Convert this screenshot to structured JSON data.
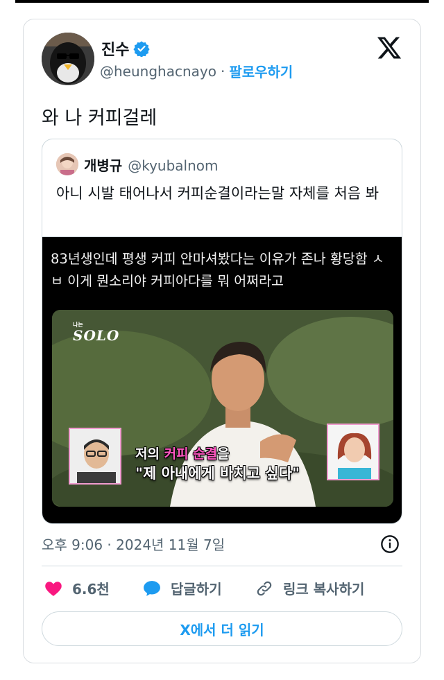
{
  "author": {
    "name": "진수",
    "handle": "@heunghacnayo",
    "separator": "·",
    "follow_label": "팔로우하기"
  },
  "tweet": {
    "text": "와 나 커피걸레"
  },
  "quoted": {
    "name": "개병규",
    "handle": "@kyubalnom",
    "text": "아니 시발 태어나서 커피순결이라는말 자체를 처음 봐",
    "media": {
      "caption": "83년생인데 평생 커피 안마셔봤다는 이유가 존나 황당함 ㅅㅂ 이게 뭔소리야 커피아다를 뭐 어쩌라고",
      "show_logo_small": "나는",
      "show_logo": "SOLO",
      "subtitle_prefix": "저의",
      "subtitle_highlight": "커피 순결",
      "subtitle_suffix": "을",
      "subtitle_line2": "\"제 아내에게 바치고 싶다\""
    }
  },
  "meta": {
    "timestamp": "오후 9:06 · 2024년 11월 7일"
  },
  "actions": {
    "likes": "6.6천",
    "reply_label": "답글하기",
    "copy_link_label": "링크 복사하기"
  },
  "read_more_label": "X에서 더 읽기",
  "colors": {
    "accent": "#1d9bf0",
    "like": "#f91880",
    "secondary_text": "#536471",
    "border": "#cfd9de"
  }
}
